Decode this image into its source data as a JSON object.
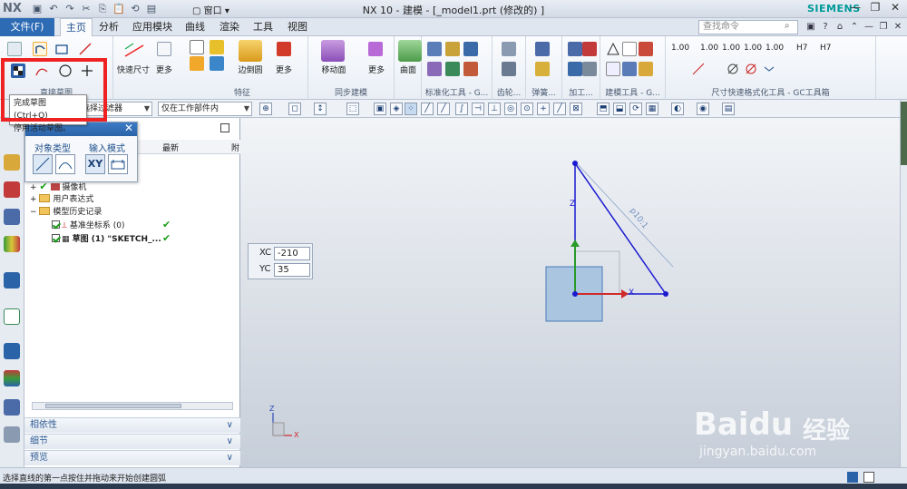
{
  "window": {
    "app_logo": "NX",
    "title": "NX 10 - 建模 - [_model1.prt (修改的) ]",
    "brand": "SIEMENS",
    "window_menu": "窗口"
  },
  "menu": {
    "file_tab": "文件(F)",
    "tabs": [
      "主页",
      "分析",
      "应用模块",
      "曲线",
      "渲染",
      "工具",
      "视图"
    ],
    "search_placeholder": "查找命令"
  },
  "ribbon": {
    "quick_dim": "快速尺寸",
    "more1": "更多",
    "edge_blend": "边倒圆",
    "more2": "更多",
    "move_face": "移动面",
    "more3": "更多",
    "surface": "曲面",
    "groups": {
      "direct_sketch": "直接草图",
      "feature": "特征",
      "sync_modeling": "同步建模",
      "std_tools": "标准化工具 - G...",
      "gear": "齿轮...",
      "spring": "弹簧...",
      "machining": "加工...",
      "modeling_tools": "建模工具 - G...",
      "dim_tools": "尺寸快速格式化工具 - GC工具箱"
    },
    "dim_labels": [
      "1.00",
      "1.00",
      "1.00",
      "1.00",
      "1.00",
      "H7",
      "H7"
    ]
  },
  "selection_bar": {
    "filter": "选择过滤器",
    "scope": "仅在工作部件内"
  },
  "tooltip": {
    "line1": "完成草图 (Ctrl+Q)",
    "line2": "停用活动草图。"
  },
  "popup": {
    "object_type": "对象类型",
    "input_mode": "输入模式",
    "xy_btn": "XY"
  },
  "navigator": {
    "col_latest": "最新",
    "col_more": "附",
    "rows": [
      {
        "label": "摄像机"
      },
      {
        "label": "用户表达式"
      },
      {
        "label": "模型历史记录"
      },
      {
        "label": "基准坐标系 (0)"
      },
      {
        "label": "草图 (1) \"SKETCH_..."
      }
    ],
    "sections": [
      "相依性",
      "细节",
      "预览"
    ]
  },
  "graphics": {
    "xc_label": "XC",
    "xc_value": "-210",
    "yc_label": "YC",
    "yc_value": "35",
    "dim_text": "p10:1",
    "axis_x": "X",
    "axis_z": "Z"
  },
  "status": {
    "text": "选择直线的第一点按住并拖动来开始创建圆弧"
  },
  "watermark": {
    "brand": "Baidu",
    "cn": "经验",
    "url": "jingyan.baidu.com"
  }
}
